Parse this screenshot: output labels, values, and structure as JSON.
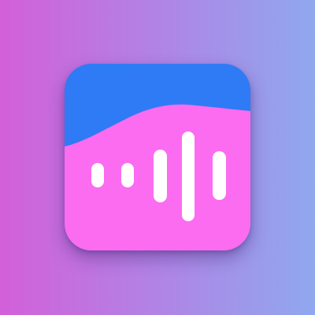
{
  "colors": {
    "background_left": "#d35fd9",
    "background_mid": "#b480e4",
    "background_right": "#8fa8ee",
    "icon_top": "#2f7bf5",
    "icon_bottom": "#fb6cf0",
    "bars": "#ffffff"
  },
  "icons": {
    "app": "audio-waveform-app-icon",
    "waveform": "sound-waveform-icon",
    "wave_shape": "wave-shape"
  }
}
